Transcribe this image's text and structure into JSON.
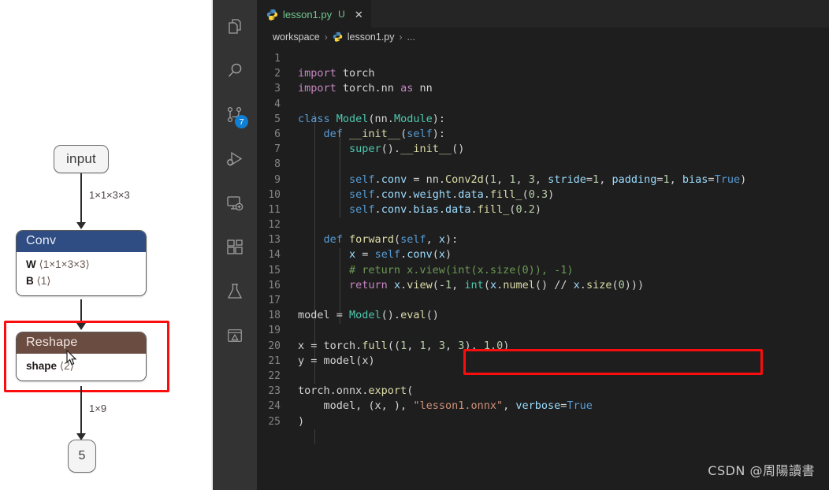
{
  "graph": {
    "input_node": {
      "label": "input"
    },
    "output_node": {
      "label": "5"
    },
    "conv_node": {
      "title": "Conv",
      "attrs": [
        {
          "name": "W",
          "value": "⟨1×1×3×3⟩"
        },
        {
          "name": "B",
          "value": "⟨1⟩"
        }
      ]
    },
    "reshape_node": {
      "title": "Reshape",
      "attrs": [
        {
          "name": "shape",
          "value": "⟨2⟩"
        }
      ]
    },
    "edges": [
      {
        "label": "1×1×3×3"
      },
      {
        "label": ""
      },
      {
        "label": "1×9"
      }
    ],
    "highlight_color": "#fb0d0d"
  },
  "activitybar": {
    "items": [
      {
        "icon": "explorer-files-icon",
        "badge": ""
      },
      {
        "icon": "search-icon",
        "badge": ""
      },
      {
        "icon": "source-control-icon",
        "badge": "7"
      },
      {
        "icon": "run-and-debug-icon",
        "badge": ""
      },
      {
        "icon": "remote-explorer-icon",
        "badge": ""
      },
      {
        "icon": "extensions-icon",
        "badge": ""
      },
      {
        "icon": "testing-flask-icon",
        "badge": ""
      },
      {
        "icon": "image-preview-icon",
        "badge": ""
      }
    ],
    "badge_color": "#0f7fd4"
  },
  "tab": {
    "icon": "python-file-icon",
    "title": "lesson1.py",
    "status": "U",
    "close": "✕"
  },
  "breadcrumbs": {
    "items": [
      "workspace",
      "lesson1.py",
      "..."
    ],
    "separator": "›"
  },
  "editor": {
    "highlight_color": "#fb0d0d",
    "lines": [
      {
        "n": 1,
        "tokens": []
      },
      {
        "n": 2,
        "tokens": [
          {
            "t": "import",
            "c": "t-kw"
          },
          {
            "t": " torch",
            "c": "t-plain"
          }
        ]
      },
      {
        "n": 3,
        "tokens": [
          {
            "t": "import",
            "c": "t-kw"
          },
          {
            "t": " torch.nn ",
            "c": "t-plain"
          },
          {
            "t": "as",
            "c": "t-kw"
          },
          {
            "t": " nn",
            "c": "t-plain"
          }
        ]
      },
      {
        "n": 4,
        "tokens": []
      },
      {
        "n": 5,
        "tokens": [
          {
            "t": "class",
            "c": "t-ctl"
          },
          {
            "t": " ",
            "c": "t-plain"
          },
          {
            "t": "Model",
            "c": "t-cls"
          },
          {
            "t": "(nn.",
            "c": "t-plain"
          },
          {
            "t": "Module",
            "c": "t-cls"
          },
          {
            "t": "):",
            "c": "t-plain"
          }
        ]
      },
      {
        "n": 6,
        "tokens": [
          {
            "t": "    ",
            "c": "t-plain"
          },
          {
            "t": "def",
            "c": "t-ctl"
          },
          {
            "t": " ",
            "c": "t-plain"
          },
          {
            "t": "__init__",
            "c": "t-fn"
          },
          {
            "t": "(",
            "c": "t-plain"
          },
          {
            "t": "self",
            "c": "t-ctl"
          },
          {
            "t": "):",
            "c": "t-plain"
          }
        ]
      },
      {
        "n": 7,
        "tokens": [
          {
            "t": "        ",
            "c": "t-plain"
          },
          {
            "t": "super",
            "c": "t-cls"
          },
          {
            "t": "().",
            "c": "t-plain"
          },
          {
            "t": "__init__",
            "c": "t-fn"
          },
          {
            "t": "()",
            "c": "t-plain"
          }
        ]
      },
      {
        "n": 8,
        "tokens": []
      },
      {
        "n": 9,
        "tokens": [
          {
            "t": "        ",
            "c": "t-plain"
          },
          {
            "t": "self",
            "c": "t-ctl"
          },
          {
            "t": ".",
            "c": "t-plain"
          },
          {
            "t": "conv",
            "c": "t-var"
          },
          {
            "t": " = nn.",
            "c": "t-plain"
          },
          {
            "t": "Conv2d",
            "c": "t-fn"
          },
          {
            "t": "(",
            "c": "t-plain"
          },
          {
            "t": "1",
            "c": "t-num"
          },
          {
            "t": ", ",
            "c": "t-plain"
          },
          {
            "t": "1",
            "c": "t-num"
          },
          {
            "t": ", ",
            "c": "t-plain"
          },
          {
            "t": "3",
            "c": "t-num"
          },
          {
            "t": ", ",
            "c": "t-plain"
          },
          {
            "t": "stride",
            "c": "t-var"
          },
          {
            "t": "=",
            "c": "t-plain"
          },
          {
            "t": "1",
            "c": "t-num"
          },
          {
            "t": ", ",
            "c": "t-plain"
          },
          {
            "t": "padding",
            "c": "t-var"
          },
          {
            "t": "=",
            "c": "t-plain"
          },
          {
            "t": "1",
            "c": "t-num"
          },
          {
            "t": ", ",
            "c": "t-plain"
          },
          {
            "t": "bias",
            "c": "t-var"
          },
          {
            "t": "=",
            "c": "t-plain"
          },
          {
            "t": "True",
            "c": "t-ctl"
          },
          {
            "t": ")",
            "c": "t-plain"
          }
        ]
      },
      {
        "n": 10,
        "tokens": [
          {
            "t": "        ",
            "c": "t-plain"
          },
          {
            "t": "self",
            "c": "t-ctl"
          },
          {
            "t": ".",
            "c": "t-plain"
          },
          {
            "t": "conv",
            "c": "t-var"
          },
          {
            "t": ".",
            "c": "t-plain"
          },
          {
            "t": "weight",
            "c": "t-var"
          },
          {
            "t": ".",
            "c": "t-plain"
          },
          {
            "t": "data",
            "c": "t-var"
          },
          {
            "t": ".",
            "c": "t-plain"
          },
          {
            "t": "fill_",
            "c": "t-fn"
          },
          {
            "t": "(",
            "c": "t-plain"
          },
          {
            "t": "0.3",
            "c": "t-num"
          },
          {
            "t": ")",
            "c": "t-plain"
          }
        ]
      },
      {
        "n": 11,
        "tokens": [
          {
            "t": "        ",
            "c": "t-plain"
          },
          {
            "t": "self",
            "c": "t-ctl"
          },
          {
            "t": ".",
            "c": "t-plain"
          },
          {
            "t": "conv",
            "c": "t-var"
          },
          {
            "t": ".",
            "c": "t-plain"
          },
          {
            "t": "bias",
            "c": "t-var"
          },
          {
            "t": ".",
            "c": "t-plain"
          },
          {
            "t": "data",
            "c": "t-var"
          },
          {
            "t": ".",
            "c": "t-plain"
          },
          {
            "t": "fill_",
            "c": "t-fn"
          },
          {
            "t": "(",
            "c": "t-plain"
          },
          {
            "t": "0.2",
            "c": "t-num"
          },
          {
            "t": ")",
            "c": "t-plain"
          }
        ]
      },
      {
        "n": 12,
        "tokens": []
      },
      {
        "n": 13,
        "tokens": [
          {
            "t": "    ",
            "c": "t-plain"
          },
          {
            "t": "def",
            "c": "t-ctl"
          },
          {
            "t": " ",
            "c": "t-plain"
          },
          {
            "t": "forward",
            "c": "t-fn"
          },
          {
            "t": "(",
            "c": "t-plain"
          },
          {
            "t": "self",
            "c": "t-ctl"
          },
          {
            "t": ", ",
            "c": "t-plain"
          },
          {
            "t": "x",
            "c": "t-var"
          },
          {
            "t": "):",
            "c": "t-plain"
          }
        ]
      },
      {
        "n": 14,
        "tokens": [
          {
            "t": "        ",
            "c": "t-plain"
          },
          {
            "t": "x",
            "c": "t-var"
          },
          {
            "t": " = ",
            "c": "t-plain"
          },
          {
            "t": "self",
            "c": "t-ctl"
          },
          {
            "t": ".",
            "c": "t-plain"
          },
          {
            "t": "conv",
            "c": "t-var"
          },
          {
            "t": "(",
            "c": "t-plain"
          },
          {
            "t": "x",
            "c": "t-var"
          },
          {
            "t": ")",
            "c": "t-plain"
          }
        ]
      },
      {
        "n": 15,
        "tokens": [
          {
            "t": "        # return x.view(int(x.size(0)), -1)",
            "c": "t-cmt"
          }
        ]
      },
      {
        "n": 16,
        "tokens": [
          {
            "t": "        ",
            "c": "t-plain"
          },
          {
            "t": "return",
            "c": "t-kw"
          },
          {
            "t": " ",
            "c": "t-plain"
          },
          {
            "t": "x",
            "c": "t-var"
          },
          {
            "t": ".",
            "c": "t-plain"
          },
          {
            "t": "view",
            "c": "t-fn"
          },
          {
            "t": "(-",
            "c": "t-plain"
          },
          {
            "t": "1",
            "c": "t-num"
          },
          {
            "t": ", ",
            "c": "t-plain"
          },
          {
            "t": "int",
            "c": "t-cls"
          },
          {
            "t": "(",
            "c": "t-plain"
          },
          {
            "t": "x",
            "c": "t-var"
          },
          {
            "t": ".",
            "c": "t-plain"
          },
          {
            "t": "numel",
            "c": "t-fn"
          },
          {
            "t": "() // ",
            "c": "t-plain"
          },
          {
            "t": "x",
            "c": "t-var"
          },
          {
            "t": ".",
            "c": "t-plain"
          },
          {
            "t": "size",
            "c": "t-fn"
          },
          {
            "t": "(",
            "c": "t-plain"
          },
          {
            "t": "0",
            "c": "t-num"
          },
          {
            "t": ")))",
            "c": "t-plain"
          }
        ]
      },
      {
        "n": 17,
        "tokens": []
      },
      {
        "n": 18,
        "tokens": [
          {
            "t": "model",
            "c": "t-plain"
          },
          {
            "t": " = ",
            "c": "t-plain"
          },
          {
            "t": "Model",
            "c": "t-cls"
          },
          {
            "t": "().",
            "c": "t-plain"
          },
          {
            "t": "eval",
            "c": "t-fn"
          },
          {
            "t": "()",
            "c": "t-plain"
          }
        ]
      },
      {
        "n": 19,
        "tokens": []
      },
      {
        "n": 20,
        "tokens": [
          {
            "t": "x",
            "c": "t-plain"
          },
          {
            "t": " = torch.",
            "c": "t-plain"
          },
          {
            "t": "full",
            "c": "t-fn"
          },
          {
            "t": "((",
            "c": "t-plain"
          },
          {
            "t": "1",
            "c": "t-num"
          },
          {
            "t": ", ",
            "c": "t-plain"
          },
          {
            "t": "1",
            "c": "t-num"
          },
          {
            "t": ", ",
            "c": "t-plain"
          },
          {
            "t": "3",
            "c": "t-num"
          },
          {
            "t": ", ",
            "c": "t-plain"
          },
          {
            "t": "3",
            "c": "t-num"
          },
          {
            "t": "), ",
            "c": "t-plain"
          },
          {
            "t": "1.0",
            "c": "t-num"
          },
          {
            "t": ")",
            "c": "t-plain"
          }
        ]
      },
      {
        "n": 21,
        "tokens": [
          {
            "t": "y",
            "c": "t-plain"
          },
          {
            "t": " = ",
            "c": "t-plain"
          },
          {
            "t": "model",
            "c": "t-plain"
          },
          {
            "t": "(",
            "c": "t-plain"
          },
          {
            "t": "x",
            "c": "t-plain"
          },
          {
            "t": ")",
            "c": "t-plain"
          }
        ]
      },
      {
        "n": 22,
        "tokens": []
      },
      {
        "n": 23,
        "tokens": [
          {
            "t": "torch.onnx.",
            "c": "t-plain"
          },
          {
            "t": "export",
            "c": "t-fn"
          },
          {
            "t": "(",
            "c": "t-plain"
          }
        ]
      },
      {
        "n": 24,
        "tokens": [
          {
            "t": "    model, (x, ), ",
            "c": "t-plain"
          },
          {
            "t": "\"lesson1.onnx\"",
            "c": "t-str"
          },
          {
            "t": ", ",
            "c": "t-plain"
          },
          {
            "t": "verbose",
            "c": "t-var"
          },
          {
            "t": "=",
            "c": "t-plain"
          },
          {
            "t": "True",
            "c": "t-ctl"
          }
        ]
      },
      {
        "n": 25,
        "tokens": [
          {
            "t": ")",
            "c": "t-plain"
          }
        ]
      }
    ]
  },
  "watermark": {
    "text": "CSDN @周陽讀書"
  }
}
